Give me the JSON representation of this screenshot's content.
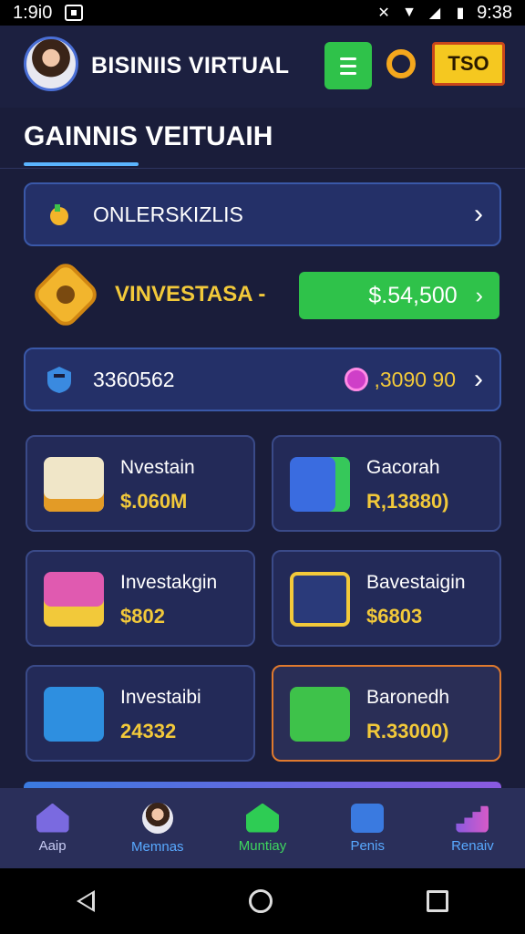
{
  "status_bar": {
    "time_left": "1:9i0",
    "time_right": "9:38"
  },
  "header": {
    "title": "BISINIIS VIRTUAL",
    "badge": "TSO"
  },
  "section": {
    "title": "GAINNIS VEITUAIH"
  },
  "row1": {
    "label": "ONLERSKIZLIS"
  },
  "invest": {
    "label": "VINVESTASA  -",
    "amount": "$.54,500"
  },
  "row3": {
    "label": "3360562",
    "value": ",3090 90"
  },
  "cards": [
    {
      "title": "Nvestain",
      "value": "$.060M",
      "icon": "document-icon"
    },
    {
      "title": "Gacorah",
      "value": "R,13880)",
      "icon": "board-icon"
    },
    {
      "title": "Investakgin",
      "value": "$802",
      "icon": "boxes-icon"
    },
    {
      "title": "Bavestaigin",
      "value": "$6803",
      "icon": "key-icon"
    },
    {
      "title": "Investaibi",
      "value": "24332",
      "icon": "chat-icon"
    },
    {
      "title": "Baronedh",
      "value": "R.33000)",
      "icon": "money-icon"
    }
  ],
  "bottom_nav": [
    {
      "label": "Aaip"
    },
    {
      "label": "Memnas"
    },
    {
      "label": "Muntiay"
    },
    {
      "label": "Penis"
    },
    {
      "label": "Renaiv"
    }
  ],
  "colors": {
    "accent_green": "#2fc24a",
    "accent_gold": "#f2c93a",
    "highlight_border": "#e07a2e"
  }
}
